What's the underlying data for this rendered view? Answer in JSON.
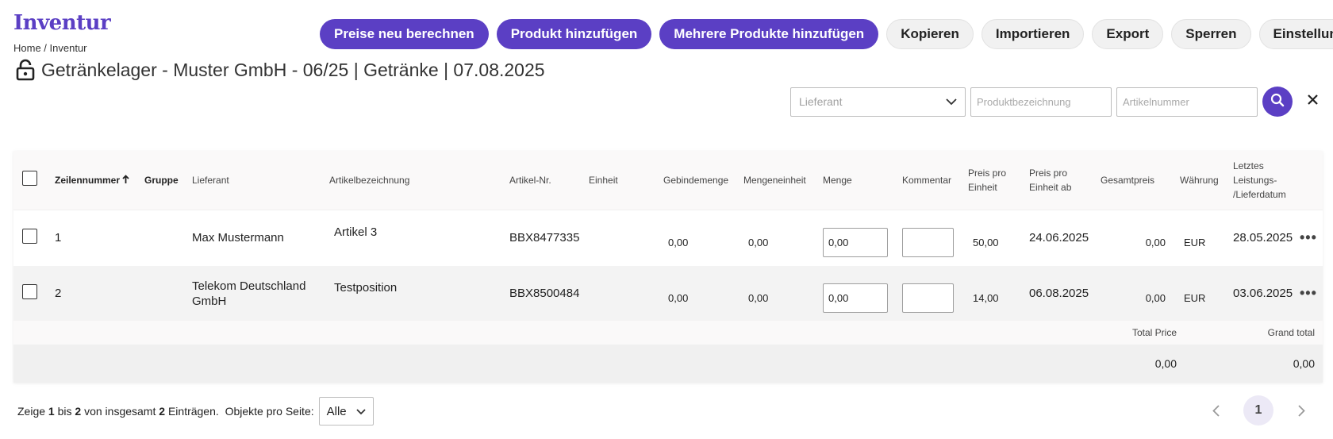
{
  "app": {
    "title": "Inventur"
  },
  "breadcrumb": {
    "home": "Home",
    "separator": " / ",
    "current": "Inventur"
  },
  "page": {
    "title": "Getränkelager - Muster GmbH - 06/25 | Getränke | 07.08.2025"
  },
  "toolbar": {
    "recalc": "Preise neu berechnen",
    "add_product": "Produkt hinzufügen",
    "add_multiple": "Mehrere Produkte hinzufügen",
    "copy": "Kopieren",
    "import": "Importieren",
    "export": "Export",
    "lock": "Sperren",
    "settings": "Einstellung"
  },
  "filters": {
    "supplier_placeholder": "Lieferant",
    "product_placeholder": "Produktbezeichnung",
    "article_placeholder": "Artikelnummer"
  },
  "table": {
    "headers": {
      "line": "Zeilennummer",
      "group": "Gruppe",
      "supplier": "Lieferant",
      "article_name": "Artikelbezeichnung",
      "article_no": "Artikel-Nr.",
      "unit": "Einheit",
      "pack_qty": "Gebindemenge",
      "qty_unit": "Mengeneinheit",
      "qty": "Menge",
      "comment": "Kommentar",
      "price_unit_1": "Preis pro",
      "price_unit_2": "Einheit",
      "price_from_1": "Preis pro",
      "price_from_2": "Einheit ab",
      "total": "Gesamtpreis",
      "currency": "Währung",
      "last_1": "Letztes",
      "last_2": "Leistungs-",
      "last_3": "/Lieferdatum"
    },
    "rows": [
      {
        "line": "1",
        "supplier_1": "Max Mustermann",
        "supplier_2": "",
        "article_name": "Artikel 3",
        "article_no": "BBX8477335",
        "pack_qty": "0,00",
        "qty_unit": "0,00",
        "qty": "0,00",
        "comment": "",
        "price_unit": "50,00",
        "price_from": "24.06.2025",
        "total": "0,00",
        "currency": "EUR",
        "last_date": "28.05.2025"
      },
      {
        "line": "2",
        "supplier_1": "Telekom Deutschland",
        "supplier_2": "GmbH",
        "article_name": "Testposition",
        "article_no": "BBX8500484",
        "pack_qty": "0,00",
        "qty_unit": "0,00",
        "qty": "0,00",
        "comment": "",
        "price_unit": "14,00",
        "price_from": "06.08.2025",
        "total": "0,00",
        "currency": "EUR",
        "last_date": "03.06.2025"
      }
    ],
    "summary": {
      "total_label": "Total Price",
      "grand_label": "Grand total",
      "total_value": "0,00",
      "grand_value": "0,00"
    }
  },
  "footer": {
    "show": "Zeige",
    "from": "1",
    "to_word": "bis",
    "to": "2",
    "of_word": "von insgesamt",
    "count": "2",
    "entries": "Einträgen.",
    "per_page_label": "Objekte pro Seite:",
    "per_page_value": "Alle"
  },
  "pagination": {
    "current_page": "1"
  },
  "icons": {
    "lock": "lock-open-icon",
    "search": "search-icon",
    "clear": "close-icon",
    "chevron": "chevron-down-icon",
    "sort": "arrow-up-icon",
    "more": "more-horizontal-icon"
  },
  "colors": {
    "accent": "#5b3fc4"
  }
}
